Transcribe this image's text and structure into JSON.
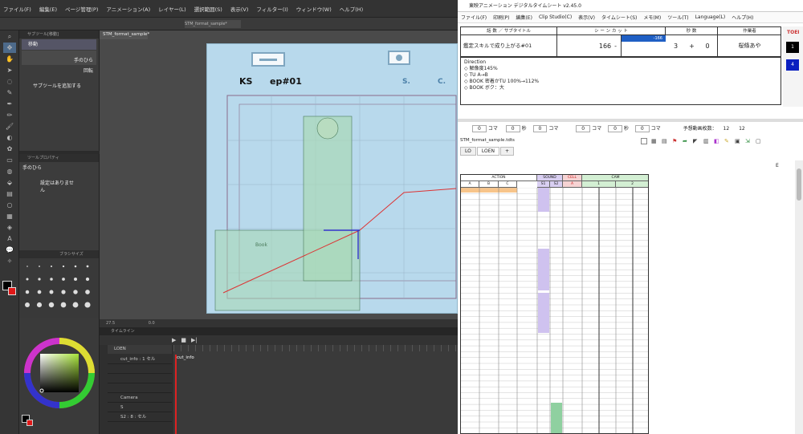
{
  "clipstudio": {
    "menu": [
      "ファイル(F)",
      "編集(E)",
      "ページ管理(P)",
      "アニメーション(A)",
      "レイヤー(L)",
      "選択範囲(S)",
      "表示(V)",
      "フィルター(I)",
      "ウィンドウ(W)",
      "ヘルプ(H)"
    ],
    "title_fragment": "STM_format_sample*",
    "doc_tab": "STM_format_sample*",
    "subtool_header": "サブツール[移動]",
    "subtool_items": [
      "移動",
      "手のひら",
      "回転"
    ],
    "add_subtool": "サブツールを追加する",
    "toolprop_header": "ツールプロパティ",
    "toolprop_title": "手のひら",
    "toolprop_empty": "設定はありません",
    "brush_header": "ブラシサイズ",
    "status_zoom": "27.5",
    "status_rot": "0.0",
    "timeline_header": "タイムライン",
    "timeline_track": "LOEN",
    "timeline_layers": [
      "cut_info : 1 セル",
      "",
      "",
      "",
      "Camera",
      "S",
      "S2 : 8 : セル"
    ],
    "timeline_cell": "cut_info",
    "canvas": {
      "ks": "KS",
      "episode": "ep#01",
      "s": "S.",
      "c": "C.",
      "note": "Book"
    }
  },
  "timesheet": {
    "title": "東映アニメーション デジタルタイムシート v2.45.0",
    "menu": [
      "ファイル(F)",
      "印刷(P)",
      "編集(E)",
      "Clip Studio(C)",
      "表示(V)",
      "タイムシート(S)",
      "メモ(M)",
      "ツール(T)",
      "Language(L)",
      "ヘルプ(H)"
    ],
    "header": {
      "cols": [
        "話 数 ／ サブタイトル",
        "シ ー ン カ ッ ト",
        "秒 数",
        "作業者"
      ],
      "subtitle": "鑑定スキルで成り上がる#01",
      "scene": "-",
      "cut": "166",
      "cut_box": "-166",
      "sec": "3",
      "plus": "+",
      "frames": "0",
      "worker": "桜條あや"
    },
    "direction_label": "Direction",
    "direction_lines": [
      "◇ 解像度145%",
      "◇ TU A→B",
      "◇ BOOK 密着かTU 100%→112%",
      "◇ BOOK ボク：大"
    ],
    "side_buttons": [
      "1",
      "4"
    ],
    "logo": "TOEI",
    "ctrl": {
      "koma": "コマ",
      "byou": "秒",
      "yosou": "予想動画枚数：",
      "count": "12",
      "count2": "12"
    },
    "file": "STM_format_sample.tdts",
    "tabs": [
      "LO",
      "LOEN",
      "+"
    ],
    "grid_headers": {
      "action": "ACTION",
      "sound": "SOUND",
      "cell": "CELL",
      "cam": "CAM",
      "a": "A",
      "b": "B",
      "c": "C",
      "s1": "S1",
      "s2": "S2",
      "ca": "A",
      "c1": "1",
      "c2": "2"
    },
    "e_label": "E"
  }
}
